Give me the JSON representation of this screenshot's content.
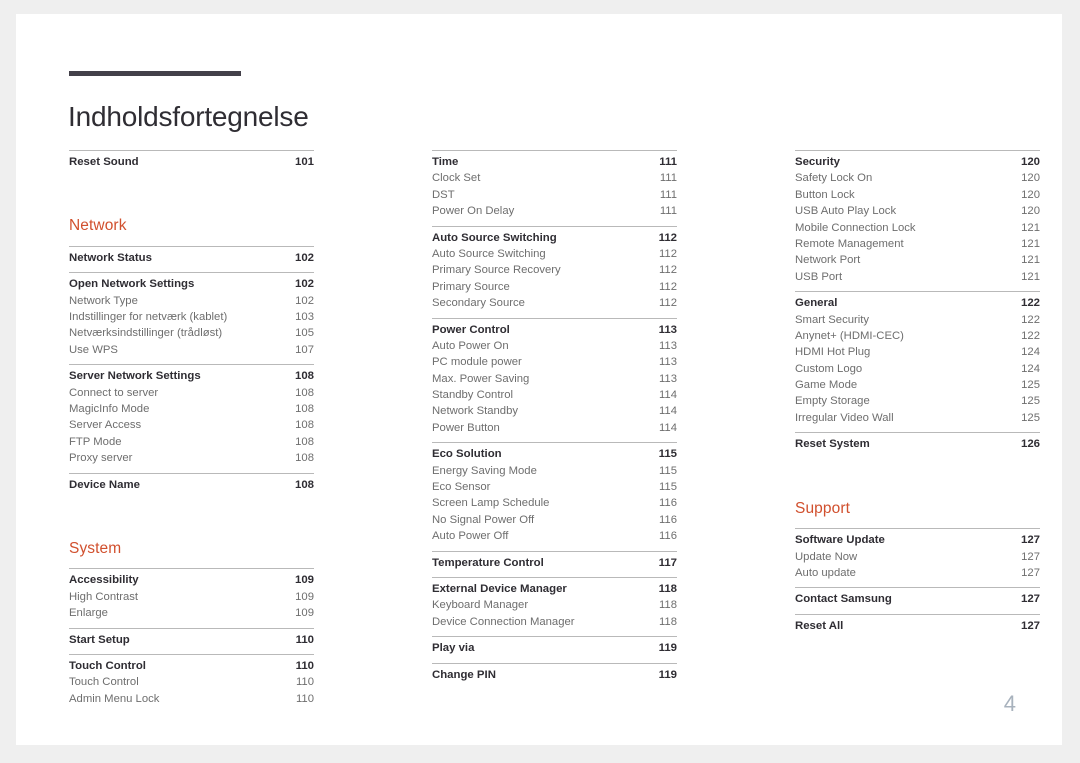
{
  "document": {
    "title": "Indholdsfortegnelse",
    "page_number": "4",
    "accent_color": "#d1502e",
    "rule_color": "#434049",
    "page_number_color": "#a8b2bd"
  },
  "columns": [
    {
      "id": "column-1",
      "blocks": [
        {
          "type": "group",
          "rows": [
            {
              "label": "Reset Sound",
              "page": "101",
              "level": 1
            }
          ]
        },
        {
          "type": "section",
          "heading": "Network",
          "groups": [
            {
              "rows": [
                {
                  "label": "Network Status",
                  "page": "102",
                  "level": 1
                }
              ]
            },
            {
              "rows": [
                {
                  "label": "Open Network Settings",
                  "page": "102",
                  "level": 1
                },
                {
                  "label": "Network Type",
                  "page": "102",
                  "level": 2
                },
                {
                  "label": "Indstillinger for netværk (kablet)",
                  "page": "103",
                  "level": 2
                },
                {
                  "label": "Netværksindstillinger (trådløst)",
                  "page": "105",
                  "level": 2
                },
                {
                  "label": "Use WPS",
                  "page": "107",
                  "level": 2
                }
              ]
            },
            {
              "rows": [
                {
                  "label": "Server Network Settings",
                  "page": "108",
                  "level": 1
                },
                {
                  "label": "Connect to server",
                  "page": "108",
                  "level": 2
                },
                {
                  "label": "MagicInfo Mode",
                  "page": "108",
                  "level": 2
                },
                {
                  "label": "Server Access",
                  "page": "108",
                  "level": 2
                },
                {
                  "label": "FTP Mode",
                  "page": "108",
                  "level": 2
                },
                {
                  "label": "Proxy server",
                  "page": "108",
                  "level": 2
                }
              ]
            },
            {
              "rows": [
                {
                  "label": "Device Name",
                  "page": "108",
                  "level": 1
                }
              ]
            }
          ]
        },
        {
          "type": "section",
          "heading": "System",
          "groups": [
            {
              "rows": [
                {
                  "label": "Accessibility",
                  "page": "109",
                  "level": 1
                },
                {
                  "label": "High Contrast",
                  "page": "109",
                  "level": 2
                },
                {
                  "label": "Enlarge",
                  "page": "109",
                  "level": 2
                }
              ]
            },
            {
              "rows": [
                {
                  "label": "Start Setup",
                  "page": "110",
                  "level": 1
                }
              ]
            },
            {
              "rows": [
                {
                  "label": "Touch Control",
                  "page": "110",
                  "level": 1
                },
                {
                  "label": "Touch Control",
                  "page": "110",
                  "level": 2
                },
                {
                  "label": "Admin Menu Lock",
                  "page": "110",
                  "level": 2
                }
              ]
            }
          ]
        }
      ]
    },
    {
      "id": "column-2",
      "blocks": [
        {
          "type": "plain",
          "groups": [
            {
              "rows": [
                {
                  "label": "Time",
                  "page": "111",
                  "level": 1
                },
                {
                  "label": "Clock Set",
                  "page": "111",
                  "level": 2
                },
                {
                  "label": "DST",
                  "page": "111",
                  "level": 2
                },
                {
                  "label": "Power On Delay",
                  "page": "111",
                  "level": 2
                }
              ]
            },
            {
              "rows": [
                {
                  "label": "Auto Source Switching",
                  "page": "112",
                  "level": 1
                },
                {
                  "label": "Auto Source Switching",
                  "page": "112",
                  "level": 2
                },
                {
                  "label": "Primary Source Recovery",
                  "page": "112",
                  "level": 2
                },
                {
                  "label": "Primary Source",
                  "page": "112",
                  "level": 2
                },
                {
                  "label": "Secondary Source",
                  "page": "112",
                  "level": 2
                }
              ]
            },
            {
              "rows": [
                {
                  "label": "Power Control",
                  "page": "113",
                  "level": 1
                },
                {
                  "label": "Auto Power On",
                  "page": "113",
                  "level": 2
                },
                {
                  "label": "PC module power",
                  "page": "113",
                  "level": 2
                },
                {
                  "label": "Max. Power Saving",
                  "page": "113",
                  "level": 2
                },
                {
                  "label": "Standby Control",
                  "page": "114",
                  "level": 2
                },
                {
                  "label": "Network Standby",
                  "page": "114",
                  "level": 2
                },
                {
                  "label": "Power Button",
                  "page": "114",
                  "level": 2
                }
              ]
            },
            {
              "rows": [
                {
                  "label": "Eco Solution",
                  "page": "115",
                  "level": 1
                },
                {
                  "label": "Energy Saving Mode",
                  "page": "115",
                  "level": 2
                },
                {
                  "label": "Eco Sensor",
                  "page": "115",
                  "level": 2
                },
                {
                  "label": "Screen Lamp Schedule",
                  "page": "116",
                  "level": 2
                },
                {
                  "label": "No Signal Power Off",
                  "page": "116",
                  "level": 2
                },
                {
                  "label": "Auto Power Off",
                  "page": "116",
                  "level": 2
                }
              ]
            },
            {
              "rows": [
                {
                  "label": "Temperature Control",
                  "page": "117",
                  "level": 1
                }
              ]
            },
            {
              "rows": [
                {
                  "label": "External Device Manager",
                  "page": "118",
                  "level": 1
                },
                {
                  "label": "Keyboard Manager",
                  "page": "118",
                  "level": 2
                },
                {
                  "label": "Device Connection Manager",
                  "page": "118",
                  "level": 2
                }
              ]
            },
            {
              "rows": [
                {
                  "label": "Play via",
                  "page": "119",
                  "level": 1
                }
              ]
            },
            {
              "rows": [
                {
                  "label": "Change PIN",
                  "page": "119",
                  "level": 1
                }
              ]
            }
          ]
        }
      ]
    },
    {
      "id": "column-3",
      "blocks": [
        {
          "type": "plain",
          "groups": [
            {
              "rows": [
                {
                  "label": "Security",
                  "page": "120",
                  "level": 1
                },
                {
                  "label": "Safety Lock On",
                  "page": "120",
                  "level": 2
                },
                {
                  "label": "Button Lock",
                  "page": "120",
                  "level": 2
                },
                {
                  "label": "USB Auto Play Lock",
                  "page": "120",
                  "level": 2
                },
                {
                  "label": "Mobile Connection Lock",
                  "page": "121",
                  "level": 2
                },
                {
                  "label": "Remote Management",
                  "page": "121",
                  "level": 2
                },
                {
                  "label": "Network Port",
                  "page": "121",
                  "level": 2
                },
                {
                  "label": "USB Port",
                  "page": "121",
                  "level": 2
                }
              ]
            },
            {
              "rows": [
                {
                  "label": "General",
                  "page": "122",
                  "level": 1
                },
                {
                  "label": "Smart Security",
                  "page": "122",
                  "level": 2
                },
                {
                  "label": "Anynet+ (HDMI-CEC)",
                  "page": "122",
                  "level": 2
                },
                {
                  "label": "HDMI Hot Plug",
                  "page": "124",
                  "level": 2
                },
                {
                  "label": "Custom Logo",
                  "page": "124",
                  "level": 2
                },
                {
                  "label": "Game Mode",
                  "page": "125",
                  "level": 2
                },
                {
                  "label": "Empty Storage",
                  "page": "125",
                  "level": 2
                },
                {
                  "label": "Irregular Video Wall",
                  "page": "125",
                  "level": 2
                }
              ]
            },
            {
              "rows": [
                {
                  "label": "Reset System",
                  "page": "126",
                  "level": 1
                }
              ]
            }
          ]
        },
        {
          "type": "section",
          "heading": "Support",
          "groups": [
            {
              "rows": [
                {
                  "label": "Software Update",
                  "page": "127",
                  "level": 1
                },
                {
                  "label": "Update Now",
                  "page": "127",
                  "level": 2
                },
                {
                  "label": "Auto update",
                  "page": "127",
                  "level": 2
                }
              ]
            },
            {
              "rows": [
                {
                  "label": "Contact Samsung",
                  "page": "127",
                  "level": 1
                }
              ]
            },
            {
              "rows": [
                {
                  "label": "Reset All",
                  "page": "127",
                  "level": 1
                }
              ]
            }
          ]
        }
      ]
    }
  ]
}
